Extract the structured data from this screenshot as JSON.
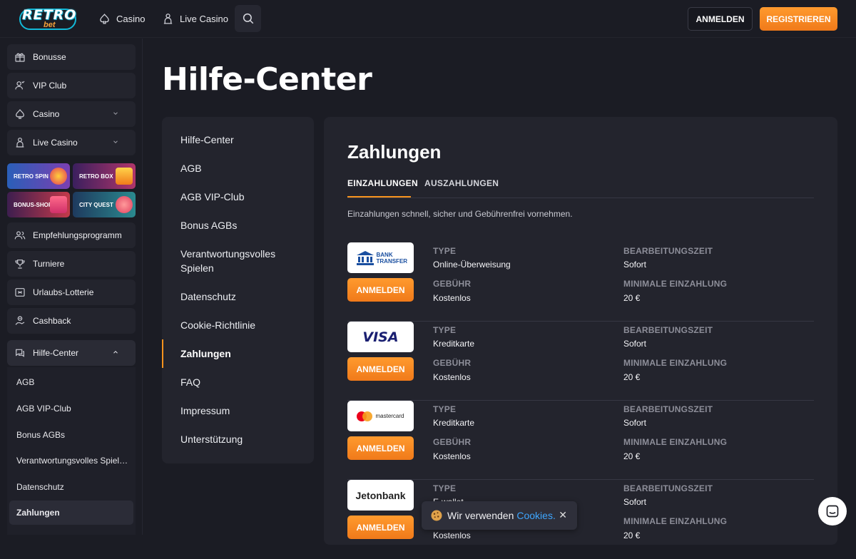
{
  "header": {
    "logo_text": "RETRO",
    "logo_sub": "bet",
    "nav": [
      "Casino",
      "Live Casino"
    ],
    "login_label": "ANMELDEN",
    "register_label": "REGISTRIEREN"
  },
  "sidebar": {
    "items": [
      {
        "label": "Bonusse",
        "icon": "gift-icon"
      },
      {
        "label": "VIP Club",
        "icon": "user-crown-icon"
      },
      {
        "label": "Casino",
        "icon": "spade-icon"
      },
      {
        "label": "Live Casino",
        "icon": "dealer-icon"
      }
    ],
    "promos": [
      "RETRO SPIN",
      "RETRO BOX",
      "BONUS-SHOP",
      "CITY QUEST"
    ],
    "items2": [
      {
        "label": "Empfehlungsprogramm",
        "icon": "people-icon"
      },
      {
        "label": "Turniere",
        "icon": "trophy-icon"
      },
      {
        "label": "Urlaubs-Lotterie",
        "icon": "ticket-icon"
      },
      {
        "label": "Cashback",
        "icon": "cashback-icon"
      }
    ],
    "help_label": "Hilfe-Center",
    "help_sub": [
      "AGB",
      "AGB VIP-Club",
      "Bonus AGBs",
      "Verantwortungsvolles Spiel…",
      "Datenschutz",
      "Zahlungen"
    ]
  },
  "main": {
    "title": "Hilfe-Center",
    "help_nav": [
      "Hilfe-Center",
      "AGB",
      "AGB VIP-Club",
      "Bonus AGBs",
      "Verantwortungsvolles Spielen",
      "Datenschutz",
      "Cookie-Richtlinie",
      "Zahlungen",
      "FAQ",
      "Impressum",
      "Unterstützung"
    ],
    "panel": {
      "title": "Zahlungen",
      "tabs": [
        "EINZAHLUNGEN",
        "AUSZAHLUNGEN"
      ],
      "intro": "Einzahlungen schnell, sicher und Gebührenfrei vornehmen.",
      "labels": {
        "type": "TYPE",
        "fee": "GEBÜHR",
        "time": "BEARBEITUNGSZEIT",
        "min": "MINIMALE EINZAHLUNG"
      },
      "button_label": "ANMELDEN",
      "methods": [
        {
          "logo": "BANK TRANSFER",
          "type": "Online-Überweisung",
          "fee": "Kostenlos",
          "time": "Sofort",
          "min": "20 €"
        },
        {
          "logo": "VISA",
          "type": "Kreditkarte",
          "fee": "Kostenlos",
          "time": "Sofort",
          "min": "20 €"
        },
        {
          "logo": "mastercard",
          "type": "Kreditkarte",
          "fee": "Kostenlos",
          "time": "Sofort",
          "min": "20 €"
        },
        {
          "logo": "Jetonbank",
          "type": "E-wallet",
          "fee": "Kostenlos",
          "time": "Sofort",
          "min": "20 €"
        }
      ]
    }
  },
  "cookie": {
    "text": "Wir verwenden",
    "link": "Cookies.",
    "close": "✕"
  },
  "colors": {
    "accent": "#f7931e",
    "bg": "#1b1c24",
    "panel": "#23242d",
    "link": "#3ea6ff"
  }
}
